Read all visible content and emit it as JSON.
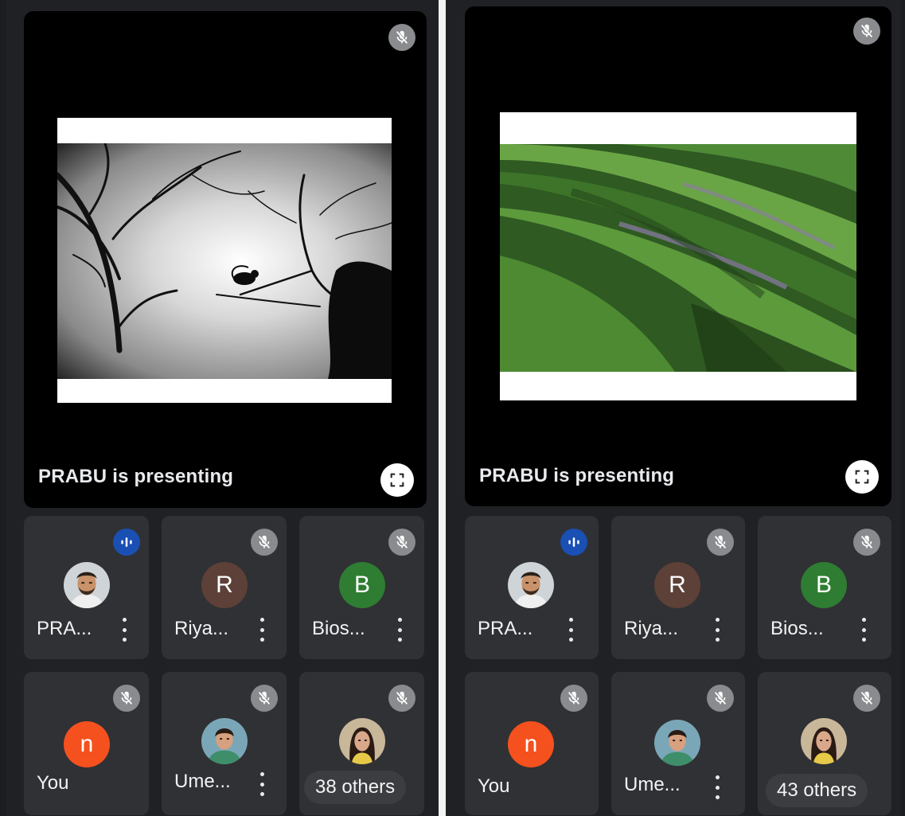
{
  "colors": {
    "background": "#202124",
    "tile": "#303134",
    "speaking_badge": "#1a4fb4",
    "avatar_riyas": "#5d4037",
    "avatar_bios": "#2e7d32",
    "avatar_you": "#f4511e"
  },
  "left": {
    "presentation_label": "PRABU is presenting",
    "slide_image": "black-and-white tree silhouette with monkey",
    "others_label": "38 others",
    "participants": [
      {
        "name": "PRA...",
        "avatar": "photo",
        "status": "speaking"
      },
      {
        "name": "Riya...",
        "avatar_letter": "R",
        "status": "muted"
      },
      {
        "name": "Bios...",
        "avatar_letter": "B",
        "status": "muted"
      },
      {
        "name": "You",
        "avatar_letter": "n",
        "status": "muted"
      },
      {
        "name": "Ume...",
        "avatar": "photo",
        "status": "muted"
      }
    ]
  },
  "right": {
    "presentation_label": "PRABU is presenting",
    "slide_image": "green rolling hills landscape",
    "others_label": "43 others",
    "participants": [
      {
        "name": "PRA...",
        "avatar": "photo",
        "status": "speaking"
      },
      {
        "name": "Riya...",
        "avatar_letter": "R",
        "status": "muted"
      },
      {
        "name": "Bios...",
        "avatar_letter": "B",
        "status": "muted"
      },
      {
        "name": "You",
        "avatar_letter": "n",
        "status": "muted"
      },
      {
        "name": "Ume...",
        "avatar": "photo",
        "status": "muted"
      }
    ]
  }
}
